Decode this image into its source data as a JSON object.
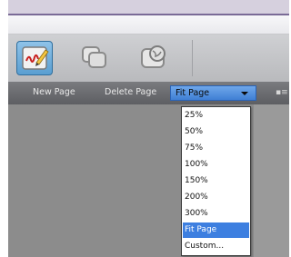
{
  "commands": {
    "new_page": "New Page",
    "delete_page": "Delete Page"
  },
  "zoom": {
    "selected": "Fit Page",
    "options": [
      "25%",
      "50%",
      "75%",
      "100%",
      "150%",
      "200%",
      "300%",
      "Fit Page",
      "Custom..."
    ]
  },
  "toolbar": {
    "tools": [
      {
        "icon": "sign-pen-icon",
        "active": true
      },
      {
        "icon": "pages-icon",
        "active": false
      },
      {
        "icon": "web-globe-icon",
        "active": false
      }
    ]
  },
  "colors": {
    "accent": "#3d7fe0",
    "title_strip": "#d6d0de",
    "command_bar": "#6a6b6f",
    "canvas": "#8c8c8c"
  }
}
